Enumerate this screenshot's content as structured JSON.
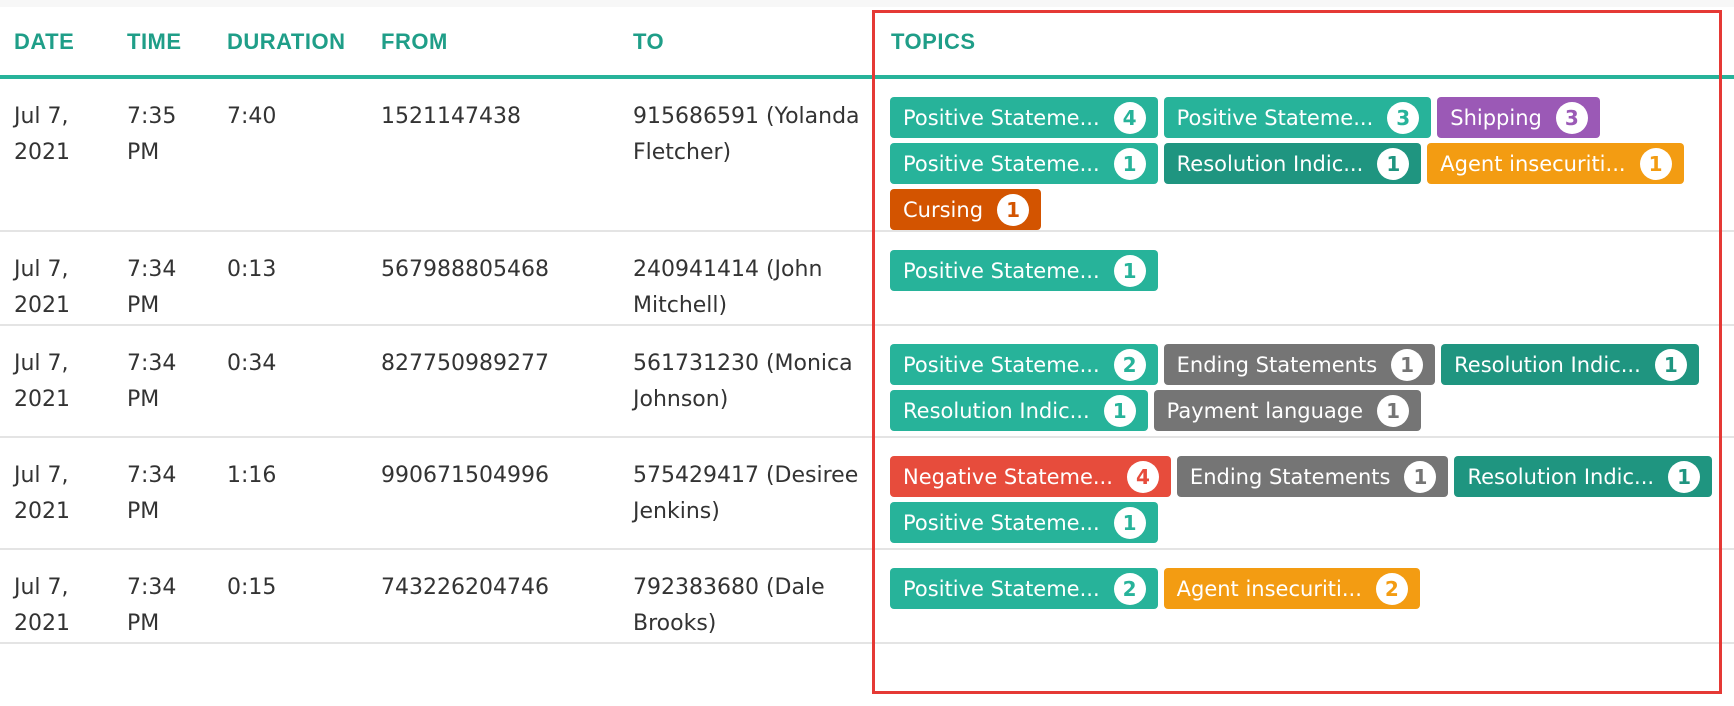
{
  "columns": {
    "date": "DATE",
    "time": "TIME",
    "duration": "DURATION",
    "from": "FROM",
    "to": "TO",
    "topics": "TOPICS"
  },
  "colors": {
    "teal": "#27b39a",
    "teal_dark": "#1f9580",
    "purple": "#9b59b6",
    "orange": "#f39c12",
    "burnt_orange": "#d35400",
    "gray": "#757575",
    "red": "#e74c3c",
    "highlight_border": "#e53935"
  },
  "rows": [
    {
      "date": "Jul 7, 2021",
      "time": "7:35 PM",
      "duration": "7:40",
      "from": "1521147438",
      "to": "915686591 (Yolanda Fletcher)",
      "topics": [
        {
          "label": "Positive Stateme...",
          "count": "4",
          "color": "teal"
        },
        {
          "label": "Positive Stateme...",
          "count": "3",
          "color": "teal"
        },
        {
          "label": "Shipping",
          "count": "3",
          "color": "purple"
        },
        {
          "label": "Positive Stateme...",
          "count": "1",
          "color": "teal"
        },
        {
          "label": "Resolution Indic...",
          "count": "1",
          "color": "teal_dark"
        },
        {
          "label": "Agent insecuriti...",
          "count": "1",
          "color": "orange"
        },
        {
          "label": "Cursing",
          "count": "1",
          "color": "burnt_orange"
        }
      ]
    },
    {
      "date": "Jul 7, 2021",
      "time": "7:34 PM",
      "duration": "0:13",
      "from": "567988805468",
      "to": "240941414 (John Mitchell)",
      "topics": [
        {
          "label": "Positive Stateme...",
          "count": "1",
          "color": "teal"
        }
      ]
    },
    {
      "date": "Jul 7, 2021",
      "time": "7:34 PM",
      "duration": "0:34",
      "from": "827750989277",
      "to": "561731230 (Monica Johnson)",
      "topics": [
        {
          "label": "Positive Stateme...",
          "count": "2",
          "color": "teal"
        },
        {
          "label": "Ending Statements",
          "count": "1",
          "color": "gray"
        },
        {
          "label": "Resolution Indic...",
          "count": "1",
          "color": "teal_dark"
        },
        {
          "label": "Resolution Indic...",
          "count": "1",
          "color": "teal"
        },
        {
          "label": "Payment language",
          "count": "1",
          "color": "gray"
        }
      ]
    },
    {
      "date": "Jul 7, 2021",
      "time": "7:34 PM",
      "duration": "1:16",
      "from": "990671504996",
      "to": "575429417 (Desiree Jenkins)",
      "topics": [
        {
          "label": "Negative Stateme...",
          "count": "4",
          "color": "red"
        },
        {
          "label": "Ending Statements",
          "count": "1",
          "color": "gray"
        },
        {
          "label": "Resolution Indic...",
          "count": "1",
          "color": "teal_dark"
        },
        {
          "label": "Positive Stateme...",
          "count": "1",
          "color": "teal"
        }
      ]
    },
    {
      "date": "Jul 7, 2021",
      "time": "7:34 PM",
      "duration": "0:15",
      "from": "743226204746",
      "to": "792383680 (Dale Brooks)",
      "topics": [
        {
          "label": "Positive Stateme...",
          "count": "2",
          "color": "teal"
        },
        {
          "label": "Agent insecuriti...",
          "count": "2",
          "color": "orange"
        }
      ]
    }
  ]
}
